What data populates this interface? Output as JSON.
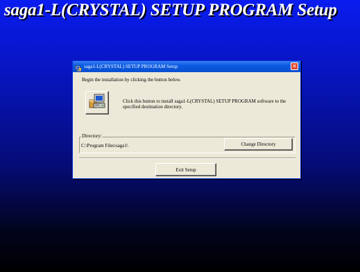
{
  "background": {
    "title": "saga1-L(CRYSTAL) SETUP PROGRAM Setup"
  },
  "dialog": {
    "title": "saga1-L(CRYSTAL) SETUP PROGRAM Setup",
    "intro": "Begin the installation by clicking the button below.",
    "install_description": "Click this button to install saga1-L(CRYSTAL) SETUP PROGRAM software to the specified destination directory.",
    "directory_label": "Directory:",
    "directory_path": "C:\\Program Files\\saga1\\",
    "change_directory_label": "Change Directory",
    "exit_label": "Exit Setup",
    "close_label": "✕"
  },
  "colors": {
    "titlebar": "#0a5ae2",
    "dialog_bg": "#ece9d8",
    "close_button": "#e0462b"
  },
  "icons": {
    "title": "setup-computer-icon",
    "install": "install-computer-icon"
  }
}
